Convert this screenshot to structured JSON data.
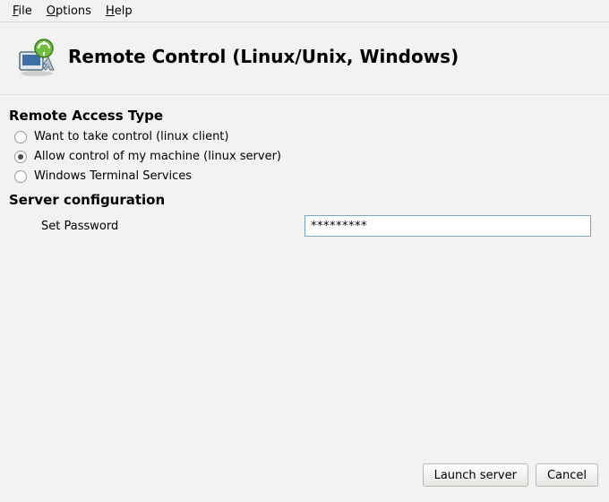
{
  "menubar": {
    "file": "File",
    "options": "Options",
    "help": "Help"
  },
  "header": {
    "title": "Remote Control (Linux/Unix, Windows)",
    "icon": "remote-control-icon"
  },
  "sections": {
    "access_type_title": "Remote Access Type",
    "server_config_title": "Server configuration"
  },
  "radios": {
    "take_control": {
      "label": "Want to take control (linux client)",
      "selected": false
    },
    "allow_control": {
      "label": "Allow control of my machine (linux server)",
      "selected": true
    },
    "windows_ts": {
      "label": "Windows Terminal Services",
      "selected": false
    }
  },
  "form": {
    "set_password_label": "Set Password",
    "password_value": "*********"
  },
  "buttons": {
    "launch": "Launch server",
    "cancel": "Cancel"
  }
}
